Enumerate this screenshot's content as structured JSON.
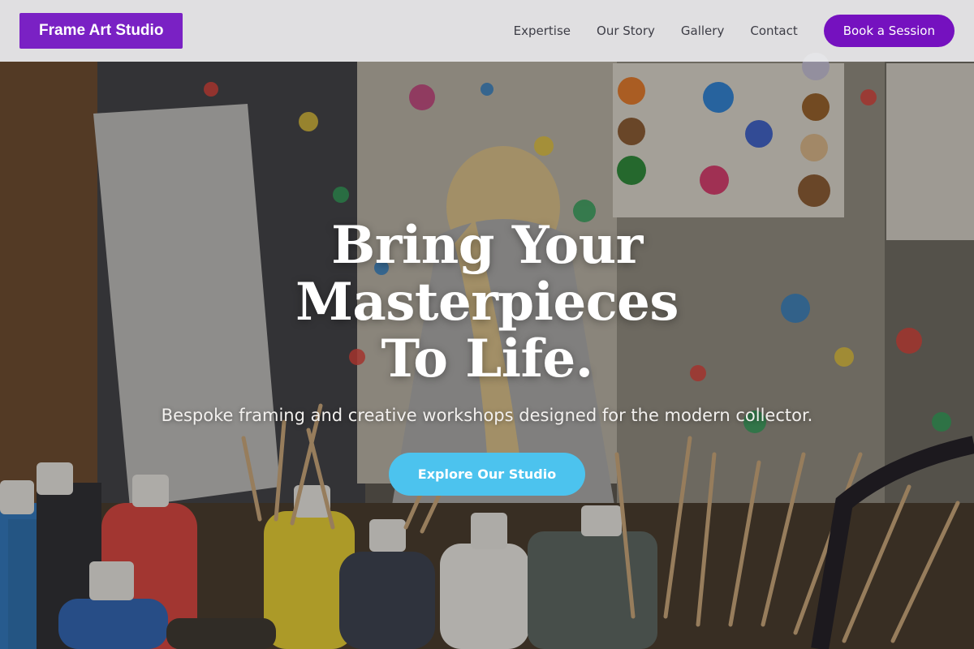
{
  "brand": {
    "name": "Frame Art Studio"
  },
  "nav": {
    "links": [
      "Expertise",
      "Our Story",
      "Gallery",
      "Contact"
    ],
    "cta_label": "Book a Session"
  },
  "hero": {
    "title_line1": "Bring Your Masterpieces",
    "title_line2": "To Life.",
    "subtitle": "Bespoke framing and creative workshops designed for the modern collector.",
    "cta_label": "Explore Our Studio",
    "background_description_icon": "paint-studio-photo"
  },
  "colors": {
    "brand": "#7a21c4",
    "book_button": "#7511bf",
    "cta": "#4cc3ee",
    "nav_bg": "#ececee"
  }
}
